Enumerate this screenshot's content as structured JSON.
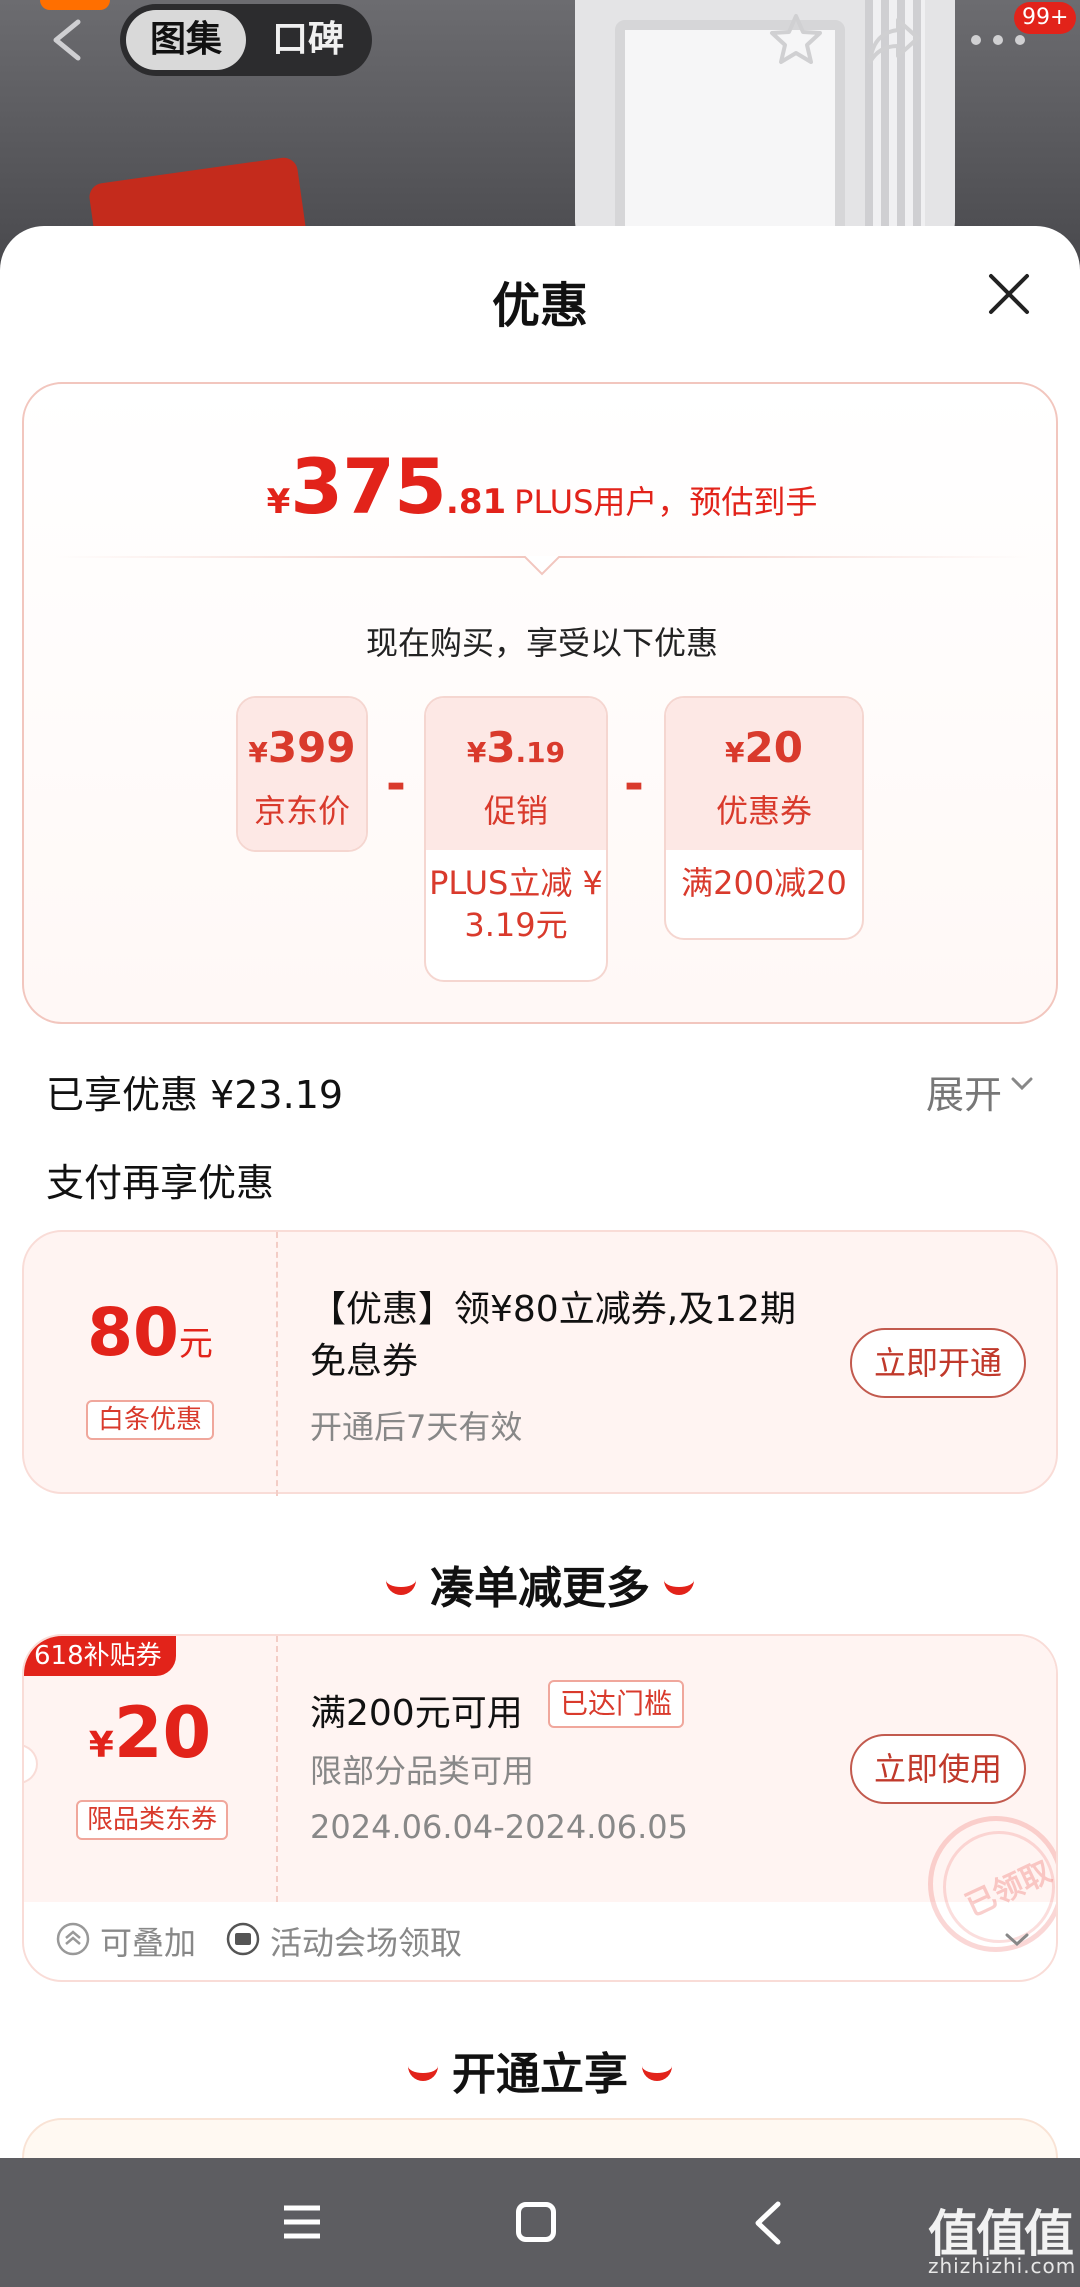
{
  "background": {
    "tabs": [
      "图集",
      "口碑"
    ],
    "notification_badge": "99+"
  },
  "sheet": {
    "title": "优惠",
    "estimate": {
      "currency": "¥",
      "integer": "375",
      "decimal": ".81",
      "suffix": "PLUS用户，预估到手"
    },
    "subtitle": "现在购买，享受以下优惠",
    "breakdown": [
      {
        "amount_currency": "¥",
        "amount": "399",
        "amount_decimal": "",
        "label": "京东价",
        "detail": ""
      },
      {
        "amount_currency": "¥",
        "amount": "3",
        "amount_decimal": ".19",
        "label": "促销",
        "detail": "PLUS立减 ¥ 3.19元"
      },
      {
        "amount_currency": "¥",
        "amount": "20",
        "amount_decimal": "",
        "label": "优惠券",
        "detail": "满200减20"
      }
    ],
    "minus_sign": "-",
    "saved": "已享优惠 ¥23.19",
    "expand_label": "展开",
    "pay_more_title": "支付再享优惠",
    "baitiao": {
      "amount": "80",
      "unit": "元",
      "tag": "白条优惠",
      "title": "【优惠】领¥80立减券,及12期免息券",
      "subtitle": "开通后7天有效",
      "button": "立即开通"
    },
    "section_more": "凑单减更多",
    "coupon": {
      "corner_tag": "618补贴券",
      "currency": "¥",
      "amount": "20",
      "tag": "限品类东券",
      "title": "满200元可用",
      "status": "已达门槛",
      "subtitle": "限部分品类可用",
      "date": "2024.06.04-2024.06.05",
      "button": "立即使用",
      "stamp": "已领取",
      "footer_stackable": "可叠加",
      "footer_source": "活动会场领取"
    },
    "section_open": "开通立享"
  },
  "watermark": {
    "text": "值值值",
    "sub": "zhizhizhi.com"
  },
  "colors": {
    "accent": "#e2231a",
    "price_red": "#d93a2c",
    "card_bg": "#fff4f2"
  }
}
